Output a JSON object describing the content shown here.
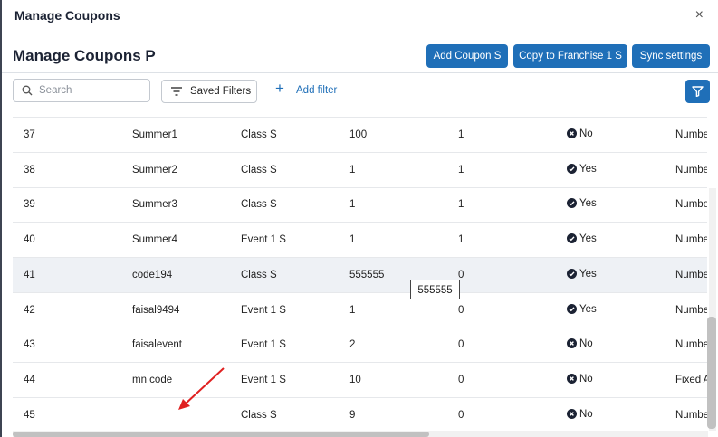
{
  "dialog": {
    "title": "Manage Coupons",
    "close_symbol": "×"
  },
  "header": {
    "title": "Manage Coupons P",
    "buttons": [
      "Add Coupon S",
      "Copy to Franchise 1 S",
      "Sync settings"
    ]
  },
  "toolbar": {
    "search_placeholder": "Search",
    "saved_filters_label": "Saved Filters",
    "add_filter_label": "Add filter",
    "add_filter_symbol": "+"
  },
  "colors": {
    "primary": "#1f6fb8",
    "row_highlight": "#eef1f5",
    "annotation_arrow": "#e02020"
  },
  "table": {
    "rows": [
      {
        "id": "37",
        "code": "Summer1",
        "category": "Class S",
        "value": "100",
        "count": "1",
        "status": "No",
        "type": "Numbe"
      },
      {
        "id": "38",
        "code": "Summer2",
        "category": "Class S",
        "value": "1",
        "count": "1",
        "status": "Yes",
        "type": "Numbe"
      },
      {
        "id": "39",
        "code": "Summer3",
        "category": "Class S",
        "value": "1",
        "count": "1",
        "status": "Yes",
        "type": "Numbe"
      },
      {
        "id": "40",
        "code": "Summer4",
        "category": "Event 1 S",
        "value": "1",
        "count": "1",
        "status": "Yes",
        "type": "Numbe"
      },
      {
        "id": "41",
        "code": "code194",
        "category": "Class S",
        "value": "555555",
        "count": "0",
        "status": "Yes",
        "type": "Numbe"
      },
      {
        "id": "42",
        "code": "faisal9494",
        "category": "Event 1 S",
        "value": "1",
        "count": "0",
        "status": "Yes",
        "type": "Numbe"
      },
      {
        "id": "43",
        "code": "faisalevent",
        "category": "Event 1 S",
        "value": "2",
        "count": "0",
        "status": "No",
        "type": "Numbe"
      },
      {
        "id": "44",
        "code": "mn code",
        "category": "Event 1 S",
        "value": "10",
        "count": "0",
        "status": "No",
        "type": "Fixed A"
      },
      {
        "id": "45",
        "code": "",
        "category": "Class S",
        "value": "9",
        "count": "0",
        "status": "No",
        "type": "Numbe"
      }
    ],
    "highlighted_row_index": 4,
    "tooltip": "555555"
  }
}
